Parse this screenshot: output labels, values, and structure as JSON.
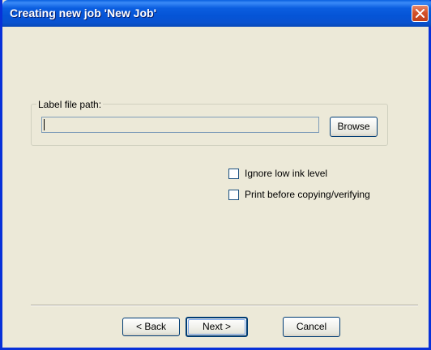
{
  "window": {
    "title": "Creating new job 'New Job'",
    "close_icon": "close-icon"
  },
  "label_file": {
    "legend": "Label file path:",
    "path_value": "",
    "browse_label": "Browse"
  },
  "options": [
    {
      "label": "Ignore low ink level",
      "checked": false
    },
    {
      "label": "Print before copying/verifying",
      "checked": false
    }
  ],
  "footer": {
    "back_label": "< Back",
    "next_label": "Next >",
    "cancel_label": "Cancel"
  },
  "colors": {
    "titlebar": "#0554d6",
    "dialog_bg": "#ece9d8",
    "close_button": "#d4522a"
  }
}
